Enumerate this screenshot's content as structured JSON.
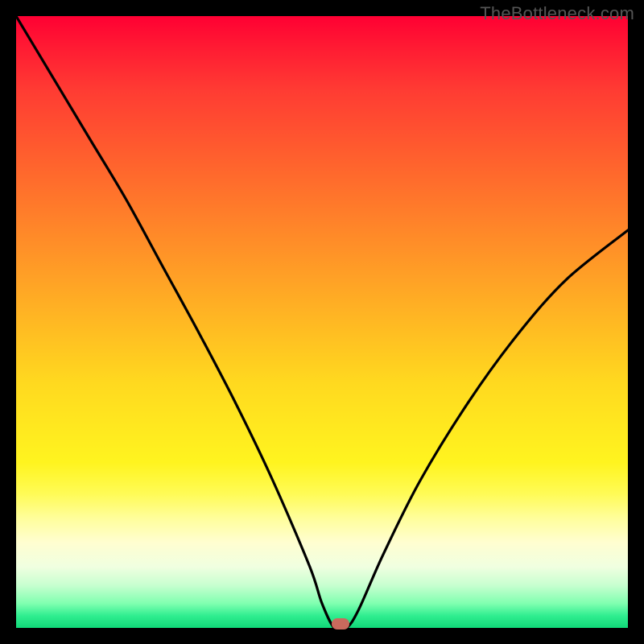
{
  "watermark": "TheBottleneck.com",
  "chart_data": {
    "type": "line",
    "title": "",
    "xlabel": "",
    "ylabel": "",
    "x_range": [
      0,
      100
    ],
    "y_range": [
      0,
      100
    ],
    "series": [
      {
        "name": "bottleneck-curve",
        "x": [
          0,
          6,
          12,
          18,
          24,
          30,
          36,
          42,
          48,
          50,
          52,
          54,
          56,
          60,
          66,
          74,
          82,
          90,
          100
        ],
        "y": [
          100,
          90,
          80,
          70,
          59,
          48,
          36.5,
          24,
          10,
          4,
          0,
          0,
          3,
          12,
          24,
          37,
          48,
          57,
          65
        ]
      }
    ],
    "marker": {
      "x": 53,
      "y": 0.7,
      "color": "#c96a5d"
    },
    "gradient_meaning": "red=high bottleneck, green=no bottleneck"
  },
  "plot": {
    "inner_left": 20,
    "inner_top": 20,
    "inner_width": 760,
    "inner_height": 760
  }
}
